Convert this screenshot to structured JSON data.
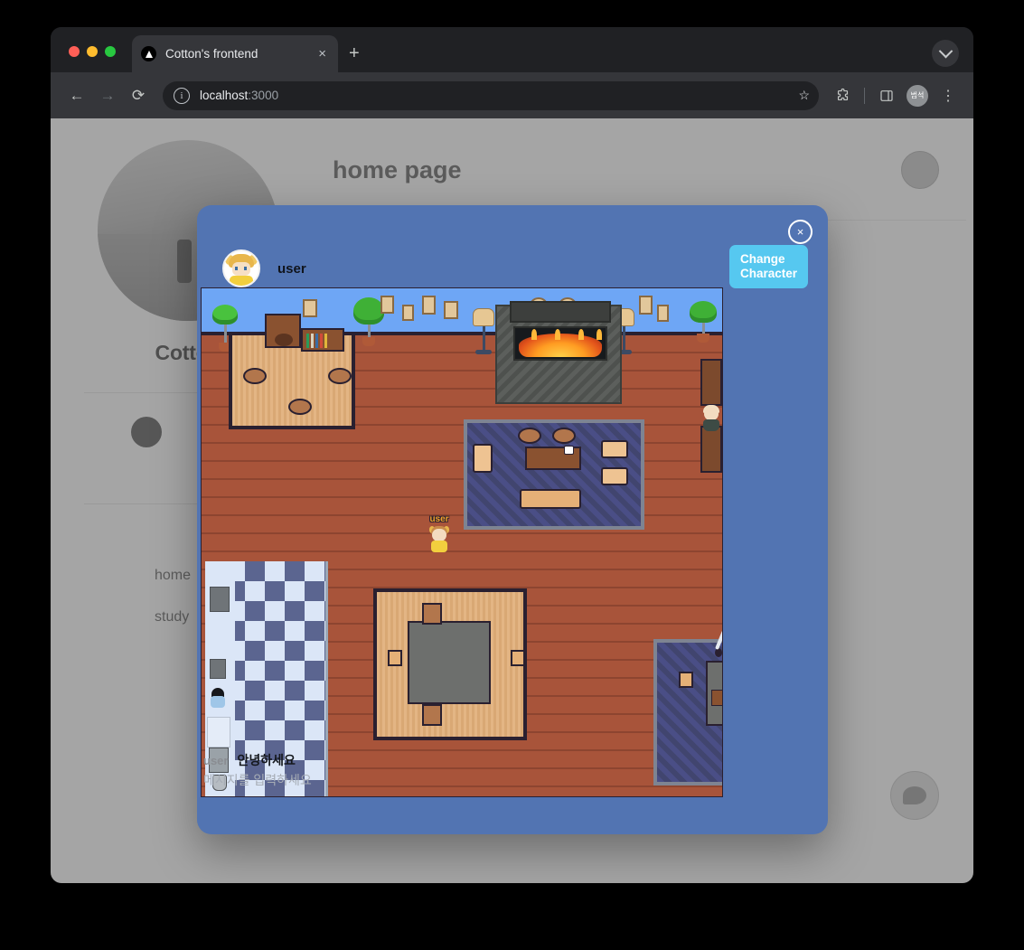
{
  "browser": {
    "tab": {
      "title": "Cotton's frontend",
      "favicon": "vercel-triangle-icon",
      "close": "×"
    },
    "new_tab_label": "+",
    "window_expand": "chevron-down-icon",
    "nav": {
      "back": "←",
      "forward": "→",
      "reload": "⟳"
    },
    "omnibox": {
      "info_icon": "i",
      "url_host": "localhost",
      "url_port": ":3000",
      "star": "☆"
    },
    "toolbar_icons": {
      "extensions": "puzzle-icon",
      "side_panel": "side-panel-icon",
      "profile_initials": "범석",
      "menu": "⋮"
    }
  },
  "page": {
    "title": "home page",
    "site_name": "Cotton",
    "nav_links": [
      "home",
      "study"
    ],
    "social": [
      "github-icon",
      "dribbble-icon"
    ],
    "fab": "chat-bubble-icon",
    "avatar": "user-avatar"
  },
  "modal": {
    "close_label": "×",
    "user_name": "user",
    "avatar": "character-avatar",
    "change_character_line1": "Change",
    "change_character_line2": "Character",
    "accent_color": "#56c8f0",
    "background_color": "#5274b2"
  },
  "game": {
    "player_name": "user",
    "npc_name": "",
    "chat": {
      "sender": "user",
      "message": "안녕하세요",
      "input_placeholder": "메시지를 입력하세요"
    }
  }
}
